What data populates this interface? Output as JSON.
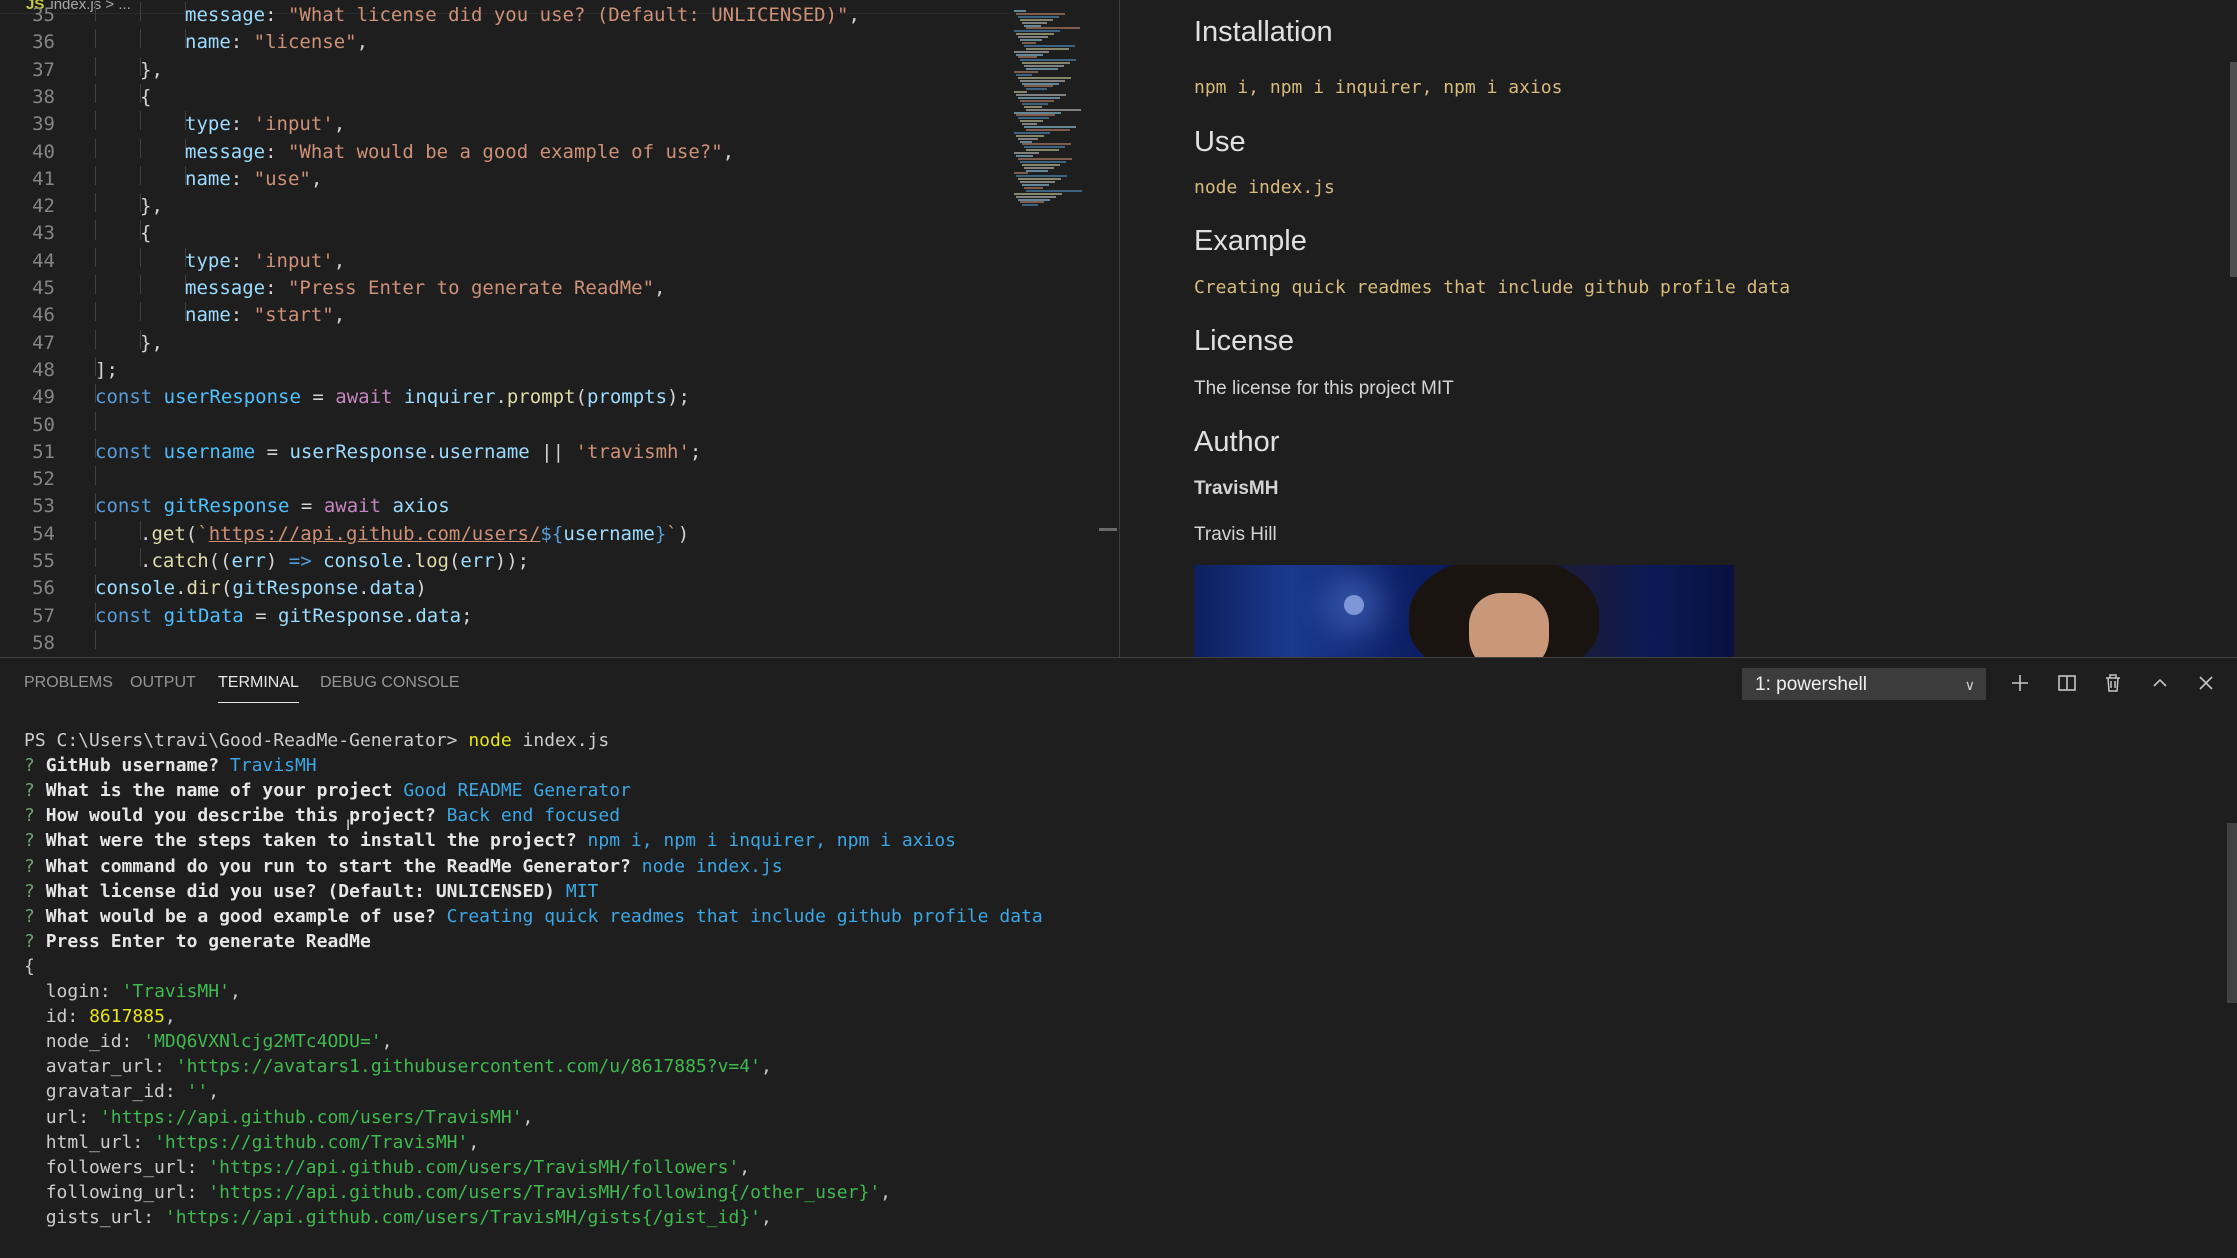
{
  "editor": {
    "breadcrumb": {
      "file_icon": "JS",
      "path": "index.js > ..."
    },
    "lines": [
      {
        "n": "35",
        "tokens": [
          [
            "t-key",
            "message"
          ],
          [
            "t-pl",
            ": "
          ],
          [
            "t-str",
            "\"What license did you use? (Default: UNLICENSED)\""
          ],
          [
            "t-pl",
            ","
          ]
        ],
        "indent": 2
      },
      {
        "n": "36",
        "tokens": [
          [
            "t-key",
            "name"
          ],
          [
            "t-pl",
            ": "
          ],
          [
            "t-str",
            "\"license\""
          ],
          [
            "t-pl",
            ","
          ]
        ],
        "indent": 2
      },
      {
        "n": "37",
        "tokens": [
          [
            "t-pl",
            "},"
          ]
        ],
        "indent": 1
      },
      {
        "n": "38",
        "tokens": [
          [
            "t-pl",
            "{"
          ]
        ],
        "indent": 1
      },
      {
        "n": "39",
        "tokens": [
          [
            "t-key",
            "type"
          ],
          [
            "t-pl",
            ": "
          ],
          [
            "t-str",
            "'input'"
          ],
          [
            "t-pl",
            ","
          ]
        ],
        "indent": 2
      },
      {
        "n": "40",
        "tokens": [
          [
            "t-key",
            "message"
          ],
          [
            "t-pl",
            ": "
          ],
          [
            "t-str",
            "\"What would be a good example of use?\""
          ],
          [
            "t-pl",
            ","
          ]
        ],
        "indent": 2
      },
      {
        "n": "41",
        "tokens": [
          [
            "t-key",
            "name"
          ],
          [
            "t-pl",
            ": "
          ],
          [
            "t-str",
            "\"use\""
          ],
          [
            "t-pl",
            ","
          ]
        ],
        "indent": 2
      },
      {
        "n": "42",
        "tokens": [
          [
            "t-pl",
            "},"
          ]
        ],
        "indent": 1
      },
      {
        "n": "43",
        "tokens": [
          [
            "t-pl",
            "{"
          ]
        ],
        "indent": 1
      },
      {
        "n": "44",
        "tokens": [
          [
            "t-key",
            "type"
          ],
          [
            "t-pl",
            ": "
          ],
          [
            "t-str",
            "'input'"
          ],
          [
            "t-pl",
            ","
          ]
        ],
        "indent": 2
      },
      {
        "n": "45",
        "tokens": [
          [
            "t-key",
            "message"
          ],
          [
            "t-pl",
            ": "
          ],
          [
            "t-str",
            "\"Press Enter to generate ReadMe\""
          ],
          [
            "t-pl",
            ","
          ]
        ],
        "indent": 2
      },
      {
        "n": "46",
        "tokens": [
          [
            "t-key",
            "name"
          ],
          [
            "t-pl",
            ": "
          ],
          [
            "t-str",
            "\"start\""
          ],
          [
            "t-pl",
            ","
          ]
        ],
        "indent": 2
      },
      {
        "n": "47",
        "tokens": [
          [
            "t-pl",
            "},"
          ]
        ],
        "indent": 1
      },
      {
        "n": "48",
        "tokens": [
          [
            "t-pl",
            "];"
          ]
        ],
        "indent": 0
      },
      {
        "n": "49",
        "tokens": [
          [
            "t-kw",
            "const "
          ],
          [
            "t-var",
            "userResponse"
          ],
          [
            "t-pl",
            " = "
          ],
          [
            "t-kw2",
            "await "
          ],
          [
            "t-key",
            "inquirer"
          ],
          [
            "t-pl",
            "."
          ],
          [
            "t-fn",
            "prompt"
          ],
          [
            "t-pl",
            "("
          ],
          [
            "t-key",
            "prompts"
          ],
          [
            "t-pl",
            ");"
          ]
        ],
        "indent": 0
      },
      {
        "n": "50",
        "tokens": [],
        "indent": 0
      },
      {
        "n": "51",
        "tokens": [
          [
            "t-kw",
            "const "
          ],
          [
            "t-var",
            "username"
          ],
          [
            "t-pl",
            " = "
          ],
          [
            "t-key",
            "userResponse"
          ],
          [
            "t-pl",
            "."
          ],
          [
            "t-key",
            "username"
          ],
          [
            "t-pl",
            " || "
          ],
          [
            "t-str",
            "'travismh'"
          ],
          [
            "t-pl",
            ";"
          ]
        ],
        "indent": 0
      },
      {
        "n": "52",
        "tokens": [],
        "indent": 0
      },
      {
        "n": "53",
        "tokens": [
          [
            "t-kw",
            "const "
          ],
          [
            "t-var",
            "gitResponse"
          ],
          [
            "t-pl",
            " = "
          ],
          [
            "t-kw2",
            "await "
          ],
          [
            "t-key",
            "axios"
          ]
        ],
        "indent": 0
      },
      {
        "n": "54",
        "tokens": [
          [
            "t-pl",
            "."
          ],
          [
            "t-fn",
            "get"
          ],
          [
            "t-pl",
            "("
          ],
          [
            "t-str",
            "`"
          ],
          [
            "t-url",
            "https://api.github.com/users/"
          ],
          [
            "t-kw",
            "${"
          ],
          [
            "t-key",
            "username"
          ],
          [
            "t-kw",
            "}"
          ],
          [
            "t-str",
            "`"
          ],
          [
            "t-pl",
            ")"
          ]
        ],
        "indent": 1
      },
      {
        "n": "55",
        "tokens": [
          [
            "t-pl",
            "."
          ],
          [
            "t-fn",
            "catch"
          ],
          [
            "t-pl",
            "(("
          ],
          [
            "t-key",
            "err"
          ],
          [
            "t-pl",
            ") "
          ],
          [
            "t-kw",
            "=>"
          ],
          [
            "t-pl",
            " "
          ],
          [
            "t-key",
            "console"
          ],
          [
            "t-pl",
            "."
          ],
          [
            "t-fn",
            "log"
          ],
          [
            "t-pl",
            "("
          ],
          [
            "t-key",
            "err"
          ],
          [
            "t-pl",
            "));"
          ]
        ],
        "indent": 1
      },
      {
        "n": "56",
        "tokens": [
          [
            "t-key",
            "console"
          ],
          [
            "t-pl",
            "."
          ],
          [
            "t-fn",
            "dir"
          ],
          [
            "t-pl",
            "("
          ],
          [
            "t-key",
            "gitResponse"
          ],
          [
            "t-pl",
            "."
          ],
          [
            "t-key",
            "data"
          ],
          [
            "t-pl",
            ")"
          ]
        ],
        "indent": 0
      },
      {
        "n": "57",
        "tokens": [
          [
            "t-kw",
            "const "
          ],
          [
            "t-var",
            "gitData"
          ],
          [
            "t-pl",
            " = "
          ],
          [
            "t-key",
            "gitResponse"
          ],
          [
            "t-pl",
            "."
          ],
          [
            "t-key",
            "data"
          ],
          [
            "t-pl",
            ";"
          ]
        ],
        "indent": 0
      },
      {
        "n": "58",
        "tokens": [],
        "indent": 0
      }
    ]
  },
  "preview": {
    "installation_heading": "Installation",
    "installation_code": "npm i, npm i inquirer, npm i axios",
    "use_heading": "Use",
    "use_code": "node index.js",
    "example_heading": "Example",
    "example_code": "Creating quick readmes that include github profile data",
    "license_heading": "License",
    "license_text": "The license for this project MIT",
    "author_heading": "Author",
    "author_username": "TravisMH",
    "author_name": "Travis Hill"
  },
  "panel": {
    "tabs": [
      "PROBLEMS",
      "OUTPUT",
      "TERMINAL",
      "DEBUG CONSOLE"
    ],
    "active_tab": "TERMINAL",
    "terminal_select": "1: powershell",
    "icons": [
      "plus-icon",
      "split-icon",
      "trash-icon",
      "chevron-up-icon",
      "close-icon"
    ]
  },
  "terminal": {
    "prompt_line": {
      "path": "PS C:\\Users\\travi\\Good-ReadMe-Generator> ",
      "cmd": "node",
      "args": " index.js"
    },
    "qa": [
      {
        "q": "GitHub username?",
        "a": "TravisMH"
      },
      {
        "q": "What is the name of your project",
        "a": "Good README Generator"
      },
      {
        "q": "How would you describe this project?",
        "a": "Back end focused"
      },
      {
        "q": "What were the steps taken to install the project?",
        "a": "npm i, npm i inquirer, npm i axios"
      },
      {
        "q": "What command do you run to start the ReadMe Generator?",
        "a": "node index.js"
      },
      {
        "q": "What license did you use? (Default: UNLICENSED)",
        "a": "MIT"
      },
      {
        "q": "What would be a good example of use?",
        "a": "Creating quick readmes that include github profile data"
      },
      {
        "q": "Press Enter to generate ReadMe",
        "a": ""
      }
    ],
    "open_brace": "{",
    "fields": [
      {
        "k": "login",
        "v": "'TravisMH'",
        "kind": "str"
      },
      {
        "k": "id",
        "v": "8617885",
        "kind": "num"
      },
      {
        "k": "node_id",
        "v": "'MDQ6VXNlcjg2MTc4ODU='",
        "kind": "str"
      },
      {
        "k": "avatar_url",
        "v": "'https://avatars1.githubusercontent.com/u/8617885?v=4'",
        "kind": "str"
      },
      {
        "k": "gravatar_id",
        "v": "''",
        "kind": "str"
      },
      {
        "k": "url",
        "v": "'https://api.github.com/users/TravisMH'",
        "kind": "str"
      },
      {
        "k": "html_url",
        "v": "'https://github.com/TravisMH'",
        "kind": "str"
      },
      {
        "k": "followers_url",
        "v": "'https://api.github.com/users/TravisMH/followers'",
        "kind": "str"
      },
      {
        "k": "following_url",
        "v": "'https://api.github.com/users/TravisMH/following{/other_user}'",
        "kind": "str"
      },
      {
        "k": "gists_url",
        "v": "'https://api.github.com/users/TravisMH/gists{/gist_id}'",
        "kind": "str"
      }
    ]
  }
}
